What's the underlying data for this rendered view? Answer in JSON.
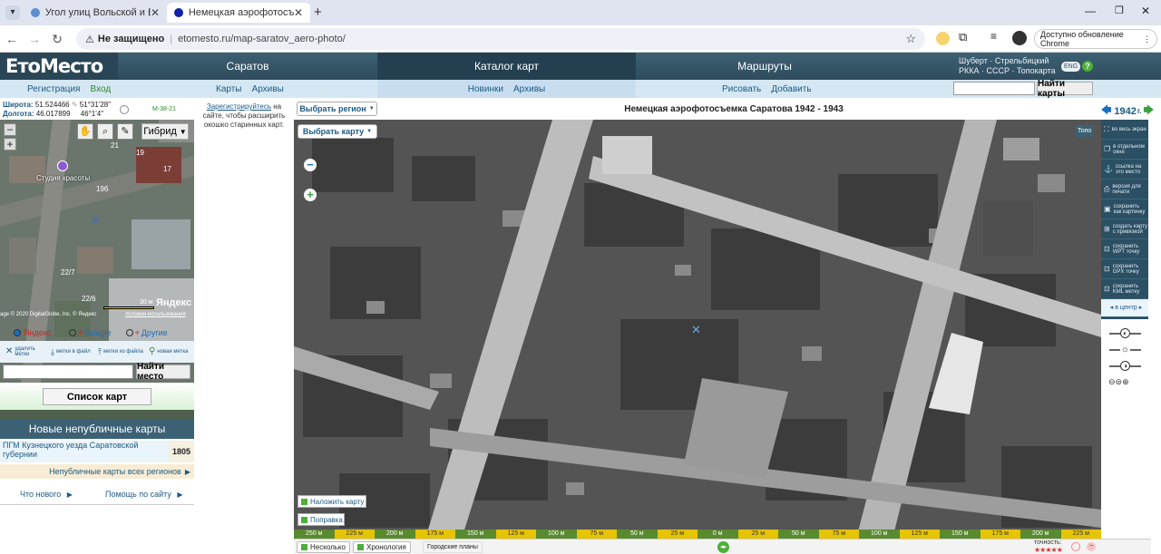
{
  "browser": {
    "tabs": [
      {
        "title": "Угол улиц Вольской и Бахмет"
      },
      {
        "title": "Немецкая аэрофотосъемка Са"
      }
    ],
    "security_label": "Не защищено",
    "url": "etomesto.ru/map-saratov_aero-photo/",
    "update_label": "Доступно обновление Chrome"
  },
  "site": {
    "logo_a": "Ето",
    "logo_b": "Место",
    "menu": [
      "Саратов",
      "Каталог карт",
      "Маршруты"
    ],
    "header_right_line1": "Шуберт · Стрельбицкий",
    "header_right_line2": "РККА · СССР · Топокарта",
    "eng": "ENG",
    "help": "?",
    "registration": "Регистрация",
    "login": "Вход",
    "sub_saratov": [
      "Карты",
      "Архивы"
    ],
    "sub_catalog": [
      "Новинки",
      "Архивы"
    ],
    "sub_routes": [
      "Рисовать",
      "Добавить"
    ],
    "find_map_button": "Найти карты"
  },
  "left": {
    "lat_label": "Широта:",
    "lat_value": "51.524466",
    "lat_dms": "51°31'28\"",
    "lon_label": "Долгота:",
    "lon_value": "46.017899",
    "lon_dms": "46°1'4\"",
    "sheet": "M-38-21",
    "hybrid": "Гибрид",
    "studio": "Студия красоты",
    "numbers": [
      "21",
      "19",
      "17",
      "19б",
      "22/7",
      "22/6"
    ],
    "copyright": "age © 2020 DigitalGlobe, Inc. © Яндекс",
    "terms": "Условия использования",
    "yandex_logo": "Яндекс",
    "scale_label": "30 м",
    "providers": [
      "Яндекс",
      "Google",
      "Другие"
    ],
    "tools": [
      {
        "icon": "remove-marks-icon",
        "label": "удалить метки"
      },
      {
        "icon": "marks-to-file-icon",
        "label": "метки в файл"
      },
      {
        "icon": "marks-from-file-icon",
        "label": "метки из файла"
      },
      {
        "icon": "new-mark-icon",
        "label": "новая метка"
      }
    ],
    "search_placeholder": "",
    "find_place_button": "Найти место",
    "map_list_button": "Список карт",
    "new_maps_header": "Новые непубличные карты",
    "new_map_item": "ПГМ Кузнецкого уезда Саратовской губернии",
    "new_map_year": "1805",
    "all_regions_link": "Непубличные карты всех регионов",
    "whats_new": "Что нового",
    "help_link": "Помощь по сайту"
  },
  "register_note": {
    "link": "Зарегистрируйтесь",
    "text": " на сайте, чтобы расширить окошко старинных карт."
  },
  "main": {
    "select_region": "Выбрать регион",
    "select_map": "Выбрать карту",
    "title": "Немецкая аэрофотосъемка Саратова 1942 - 1943",
    "year": "1942",
    "year_suffix": "г.",
    "topo": "Топо",
    "overlay_button": "Наложить карту",
    "correction_button": "Поправка",
    "right_tools": [
      "во весь экран",
      "в отдельном окне",
      "ссылка на это место",
      "версия для печати",
      "сохранить как картинку",
      "создать карту с привязкой",
      "сохранить WPT точку",
      "сохранить GPX точку",
      "сохранить KML метку"
    ],
    "center_label": "в центр",
    "scale_labels": [
      "250 м",
      "225 м",
      "200 м",
      "175 м",
      "150 м",
      "125 м",
      "100 м",
      "75 м",
      "50 м",
      "25 м",
      "0 м",
      "25 м",
      "50 м",
      "75 м",
      "100 м",
      "125 м",
      "150 м",
      "175 м",
      "200 м",
      "225 м"
    ],
    "bottom": {
      "several": "Несколько",
      "chronology": "Хронология",
      "city_plans": "Городские планы",
      "accuracy": "точность:"
    }
  }
}
